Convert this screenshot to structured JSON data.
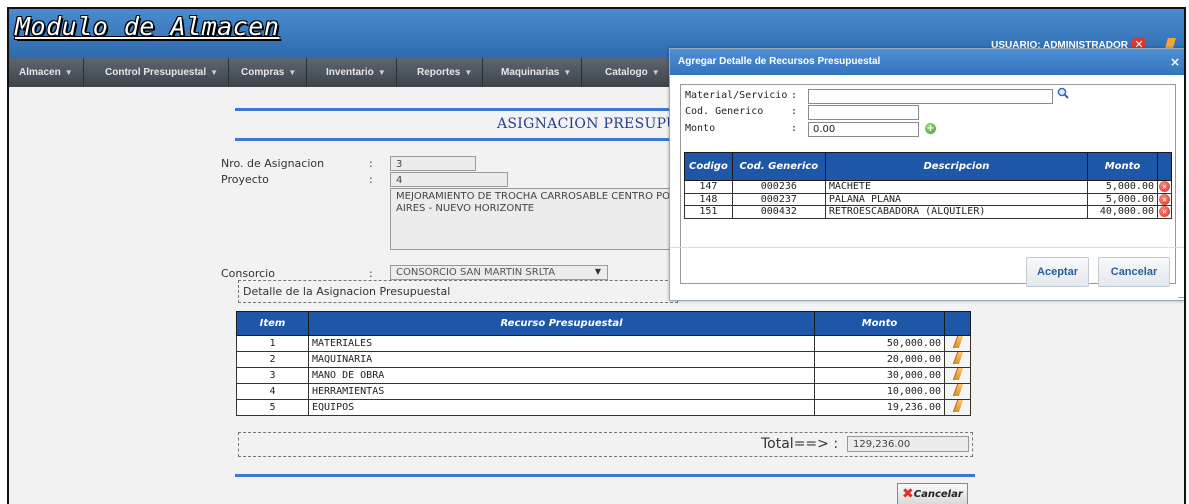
{
  "header": {
    "app_title": "Modulo de Almacen",
    "user_label": "USUARIO: ADMINISTRADOR"
  },
  "menu": [
    {
      "label": "Almacen"
    },
    {
      "label": "Control Presupuestal"
    },
    {
      "label": "Compras"
    },
    {
      "label": "Inventario"
    },
    {
      "label": "Reportes"
    },
    {
      "label": "Maquinarias"
    },
    {
      "label": "Catalogo"
    }
  ],
  "form": {
    "heading": "ASIGNACION PRESUPUE",
    "nro_label": "Nro. de Asignacion",
    "nro_value": "3",
    "proyecto_label": "Proyecto",
    "proyecto_code": "4",
    "proyecto_desc": "MEJORAMIENTO DE TROCHA CARROSABLE CENTRO PO\nAIRES - NUEVO HORIZONTE",
    "consorcio_label": "Consorcio",
    "consorcio_value": "CONSORCIO SAN MARTIN SRLTA",
    "colon": ":"
  },
  "detalle": {
    "title": "Detalle de la Asignacion Presupuestal",
    "columns": [
      "Item",
      "Recurso Presupuestal",
      "Monto"
    ],
    "rows": [
      {
        "item": "1",
        "recurso": "MATERIALES",
        "monto": "50,000.00"
      },
      {
        "item": "2",
        "recurso": "MAQUINARIA",
        "monto": "20,000.00"
      },
      {
        "item": "3",
        "recurso": "MANO DE OBRA",
        "monto": "30,000.00"
      },
      {
        "item": "4",
        "recurso": "HERRAMIENTAS",
        "monto": "10,000.00"
      },
      {
        "item": "5",
        "recurso": "EQUIPOS",
        "monto": "19,236.00"
      }
    ],
    "total_label": "Total==> :",
    "total_value": "129,236.00",
    "cancel_label": "Cancelar"
  },
  "dialog": {
    "title": "Agregar Detalle de Recursos Presupuestal",
    "close": "×",
    "material_label": "Material/Servicio",
    "codgen_label": "Cod. Generico",
    "monto_label": "Monto",
    "colon": ":",
    "material_value": "",
    "codgen_value": "",
    "monto_value": "0.00",
    "columns": [
      "Codigo",
      "Cod. Generico",
      "Descripcion",
      "Monto"
    ],
    "rows": [
      {
        "codigo": "147",
        "cod_generico": "000236",
        "descripcion": "MACHETE",
        "monto": "5,000.00"
      },
      {
        "codigo": "148",
        "cod_generico": "000237",
        "descripcion": "PALANA PLANA",
        "monto": "5,000.00"
      },
      {
        "codigo": "151",
        "cod_generico": "000432",
        "descripcion": "RETROESCABADORA (ALQUILER)",
        "monto": "40,000.00"
      }
    ],
    "accept_label": "Aceptar",
    "cancel_label": "Cancelar"
  },
  "colors": {
    "header_blue": "#3a78c2",
    "table_header": "#1e56a8",
    "menubar": "#4a525a",
    "delete_red": "#d22f20",
    "add_green": "#3e9a22"
  }
}
